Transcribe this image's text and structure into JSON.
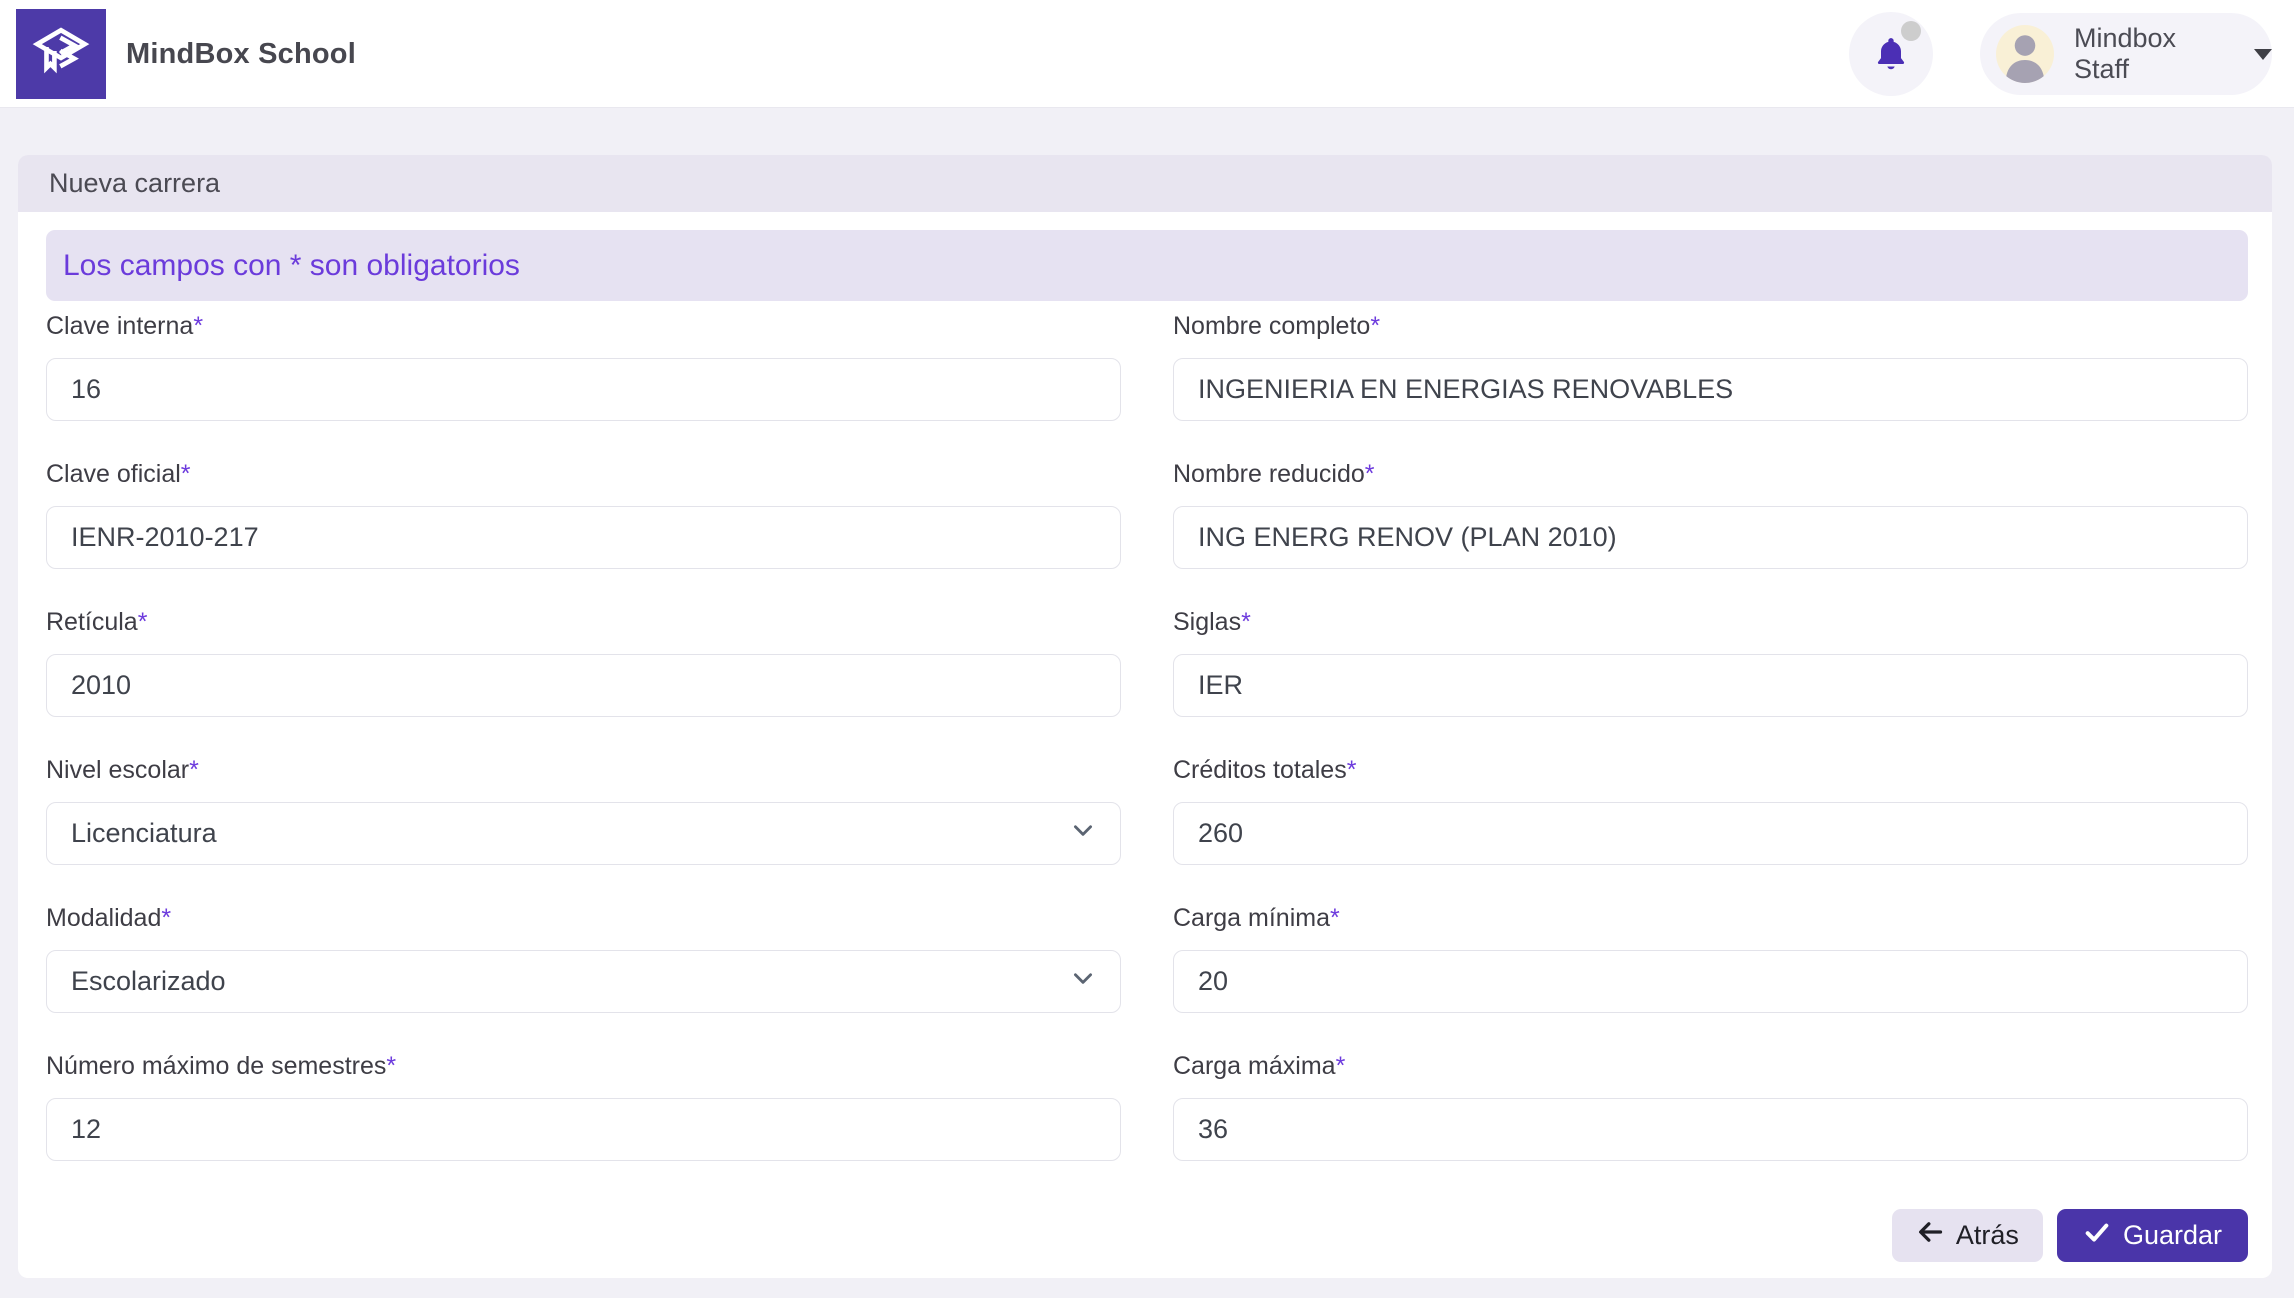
{
  "header": {
    "brand": "MindBox School",
    "user": {
      "name": "Mindbox Staff"
    }
  },
  "card": {
    "title": "Nueva carrera",
    "alert": "Los campos con * son obligatorios",
    "required_mark": "*"
  },
  "form": {
    "left": [
      {
        "label": "Clave interna",
        "value": "16",
        "type": "text"
      },
      {
        "label": "Clave oficial",
        "value": "IENR-2010-217",
        "type": "text"
      },
      {
        "label": "Retícula",
        "value": "2010",
        "type": "text"
      },
      {
        "label": "Nivel escolar",
        "value": "Licenciatura",
        "type": "select"
      },
      {
        "label": "Modalidad",
        "value": "Escolarizado",
        "type": "select"
      },
      {
        "label": "Número máximo de semestres",
        "value": "12",
        "type": "text"
      }
    ],
    "right": [
      {
        "label": "Nombre completo",
        "value": "INGENIERIA EN ENERGIAS RENOVABLES",
        "type": "text"
      },
      {
        "label": "Nombre reducido",
        "value": "ING ENERG RENOV (PLAN 2010)",
        "type": "text"
      },
      {
        "label": "Siglas",
        "value": "IER",
        "type": "text"
      },
      {
        "label": "Créditos totales",
        "value": "260",
        "type": "text"
      },
      {
        "label": "Carga mínima",
        "value": "20",
        "type": "text"
      },
      {
        "label": "Carga máxima",
        "value": "36",
        "type": "text"
      }
    ]
  },
  "actions": {
    "back": "Atrás",
    "save": "Guardar"
  },
  "icons": {
    "logo": "graduation-cap-icon",
    "notification": "bell-icon",
    "user": "person-avatar-icon",
    "dropdown": "caret-down-icon",
    "select": "chevron-down-icon",
    "back": "arrow-left-icon",
    "save": "check-icon"
  },
  "colors": {
    "logo_purple": "#4d3aa8",
    "bell_purple": "#4b2fb5",
    "alert_text": "#6b3bdb",
    "save_button": "#4a35a9",
    "card_header_bg": "#e8e5f0",
    "page_bg": "#f1f0f6"
  }
}
